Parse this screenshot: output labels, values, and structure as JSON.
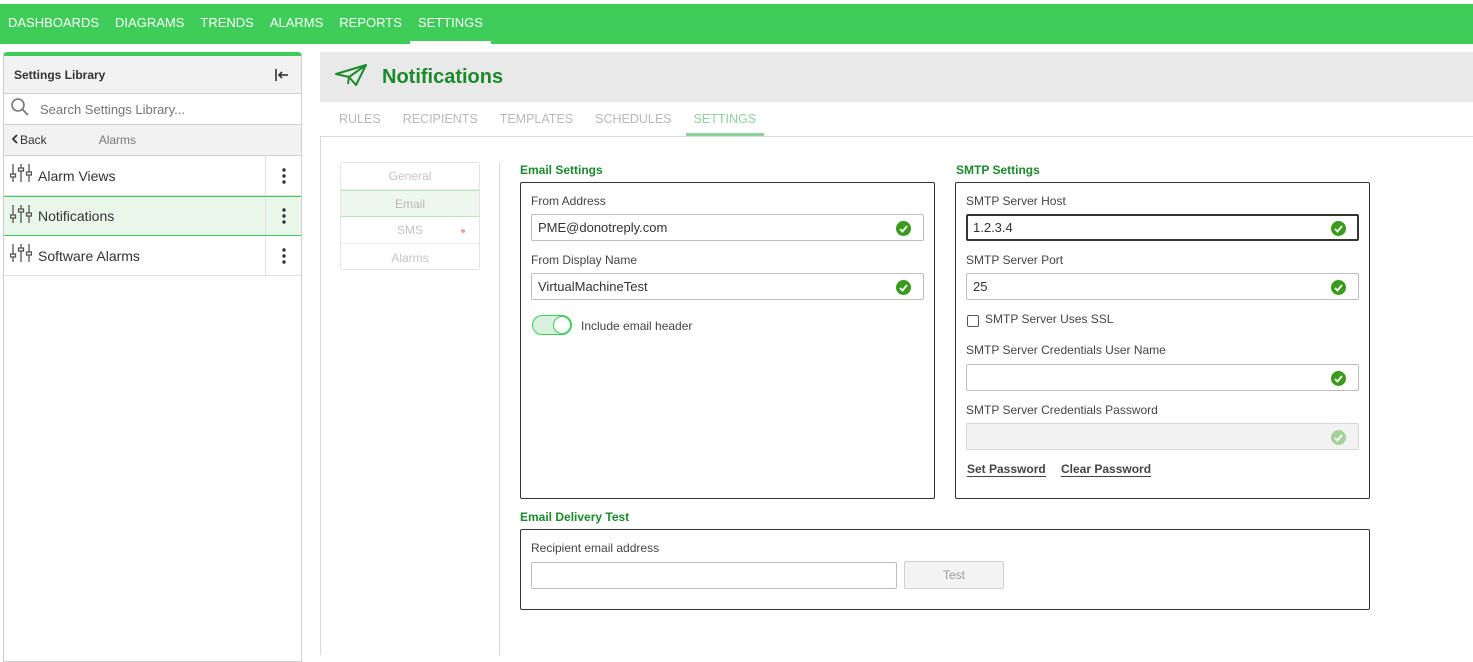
{
  "topnav": {
    "items": [
      "DASHBOARDS",
      "DIAGRAMS",
      "TRENDS",
      "ALARMS",
      "REPORTS",
      "SETTINGS"
    ],
    "active": "SETTINGS"
  },
  "sidebar": {
    "title": "Settings Library",
    "search_placeholder": "Search Settings Library...",
    "back_label": "Back",
    "breadcrumb": "Alarms",
    "items": [
      {
        "label": "Alarm Views",
        "icon": "sliders-icon"
      },
      {
        "label": "Notifications",
        "icon": "sliders-icon",
        "selected": true
      },
      {
        "label": "Software Alarms",
        "icon": "sliders-icon"
      }
    ]
  },
  "header": {
    "title": "Notifications",
    "icon": "paper-plane-icon"
  },
  "tabs": [
    "RULES",
    "RECIPIENTS",
    "TEMPLATES",
    "SCHEDULES",
    "SETTINGS"
  ],
  "active_tab": "SETTINGS",
  "subnav": [
    "General",
    "Email",
    "SMS",
    "Alarms"
  ],
  "active_subnav": "Email",
  "email_settings": {
    "title": "Email Settings",
    "from_address_label": "From Address",
    "from_address_value": "PME@donotreply.com",
    "from_display_label": "From Display Name",
    "from_display_value": "VirtualMachineTest",
    "include_header_label": "Include email header",
    "include_header_on": true
  },
  "smtp_settings": {
    "title": "SMTP Settings",
    "host_label": "SMTP Server Host",
    "host_value": "1.2.3.4",
    "port_label": "SMTP Server Port",
    "port_value": "25",
    "ssl_label": "SMTP Server Uses SSL",
    "ssl_checked": false,
    "user_label": "SMTP Server Credentials User Name",
    "user_value": "",
    "password_label": "SMTP Server Credentials Password",
    "password_value": "",
    "set_password": "Set Password",
    "clear_password": "Clear Password"
  },
  "delivery_test": {
    "title": "Email Delivery Test",
    "recipient_label": "Recipient email address",
    "recipient_value": "",
    "test_button": "Test"
  },
  "colors": {
    "brand_green": "#3dcd58",
    "title_green": "#1a8a2c",
    "check_green": "#3a9a1c"
  }
}
